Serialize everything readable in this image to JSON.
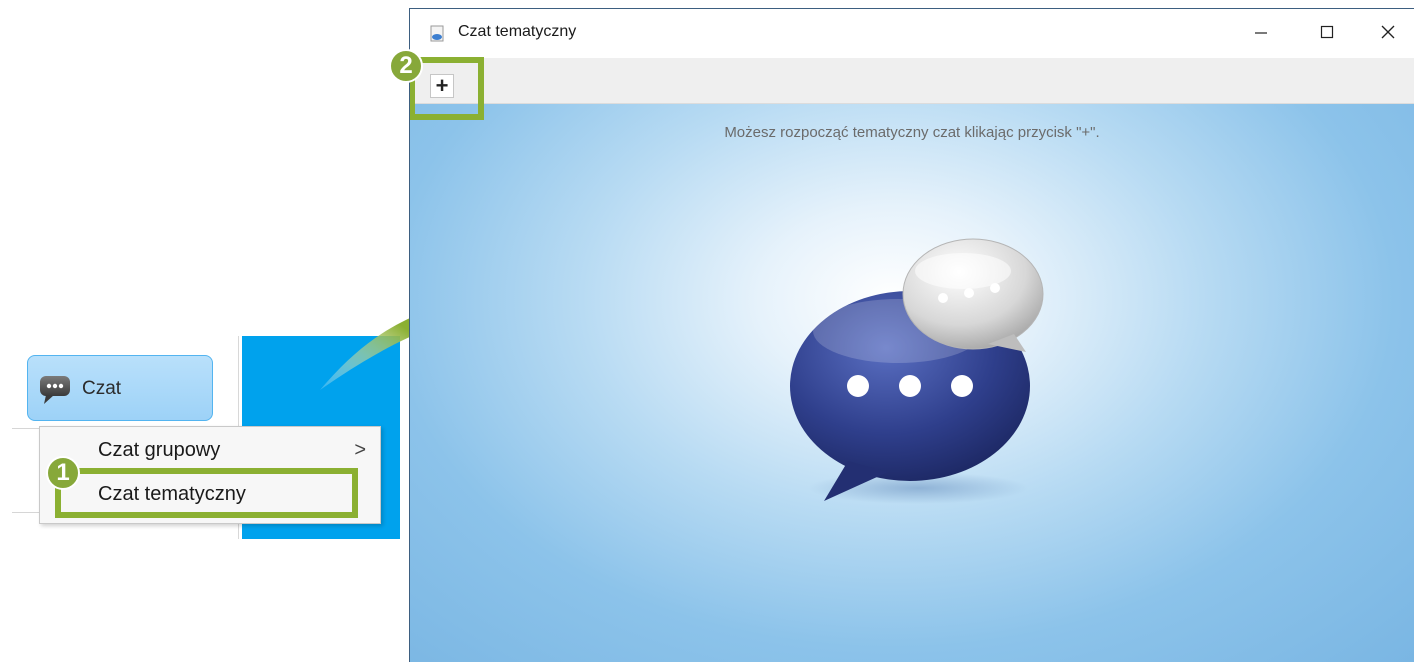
{
  "sidebar": {
    "chat_button_label": "Czat",
    "menu": {
      "items": [
        {
          "label": "Czat grupowy",
          "has_submenu": true
        },
        {
          "label": "Czat tematyczny",
          "has_submenu": false
        }
      ],
      "submenu_chevron": ">"
    }
  },
  "annotations": {
    "step1": "1",
    "step2": "2",
    "highlight_color": "#8bb032"
  },
  "window": {
    "title": "Czat tematyczny",
    "controls": {
      "minimize": "minimize-icon",
      "maximize": "maximize-icon",
      "close": "close-icon"
    },
    "toolbar": {
      "add_label": "+"
    },
    "hint": "Możesz rozpocząć tematyczny czat klikając przycisk \"+\"."
  },
  "colors": {
    "accent_blue": "#00a2ed",
    "content_bg": "#8cc3ea",
    "bubble_dark": "#2f3f8c"
  }
}
